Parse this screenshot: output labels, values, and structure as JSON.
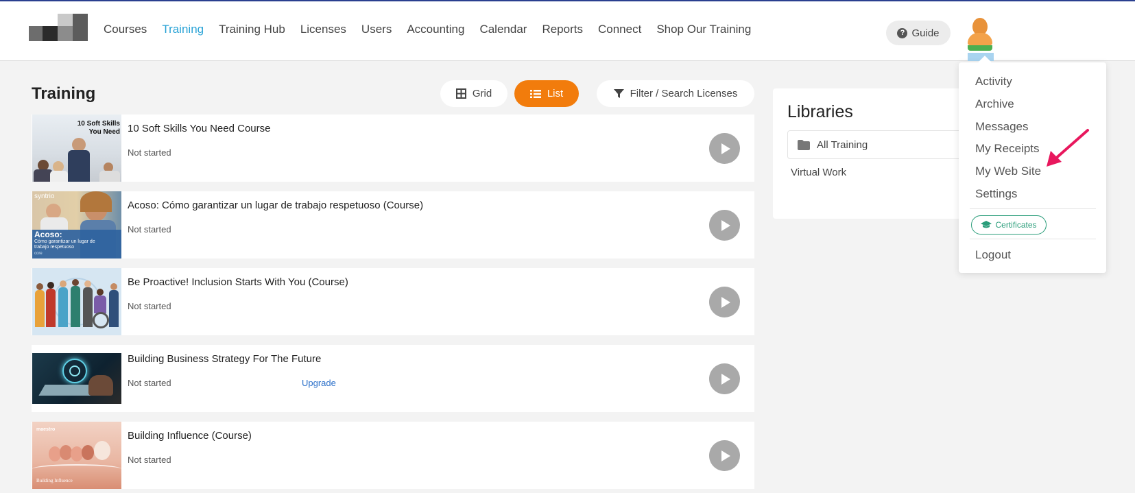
{
  "nav": {
    "items": [
      "Courses",
      "Training",
      "Training Hub",
      "Licenses",
      "Users",
      "Accounting",
      "Calendar",
      "Reports",
      "Connect",
      "Shop Our Training"
    ],
    "active": "Training"
  },
  "header": {
    "guide_label": "Guide"
  },
  "training": {
    "title": "Training",
    "grid_label": "Grid",
    "list_label": "List",
    "filter_label": "Filter / Search Licenses",
    "thumb_text": {
      "soft_skills": "10 Soft Skills You Need",
      "syntrio": "syntrio",
      "acoso_title": "Acoso:",
      "acoso_sub": "Cómo garantizar un lugar de trabajo respetuoso",
      "acoso_tag": "core",
      "maestro": "maestro",
      "influence": "Building Influence"
    },
    "courses": [
      {
        "title": "10 Soft Skills You Need Course",
        "status": "Not started"
      },
      {
        "title": "Acoso: Cómo garantizar un lugar de trabajo respetuoso (Course)",
        "status": "Not started"
      },
      {
        "title": "Be Proactive! Inclusion Starts With You (Course)",
        "status": "Not started"
      },
      {
        "title": "Building Business Strategy For The Future",
        "status": "Not started",
        "action": "Upgrade"
      },
      {
        "title": "Building Influence (Course)",
        "status": "Not started"
      }
    ]
  },
  "libraries": {
    "title": "Libraries",
    "items": [
      "All Training",
      "Virtual Work"
    ]
  },
  "user_menu": {
    "items": [
      "Activity",
      "Archive",
      "Messages",
      "My Receipts",
      "My Web Site",
      "Settings"
    ],
    "certificates_label": "Certificates",
    "logout_label": "Logout"
  },
  "colors": {
    "accent": "#f27c0c",
    "active_nav": "#2aa3d6",
    "certificates": "#2a9d7a",
    "annotation_arrow": "#e8175d"
  }
}
